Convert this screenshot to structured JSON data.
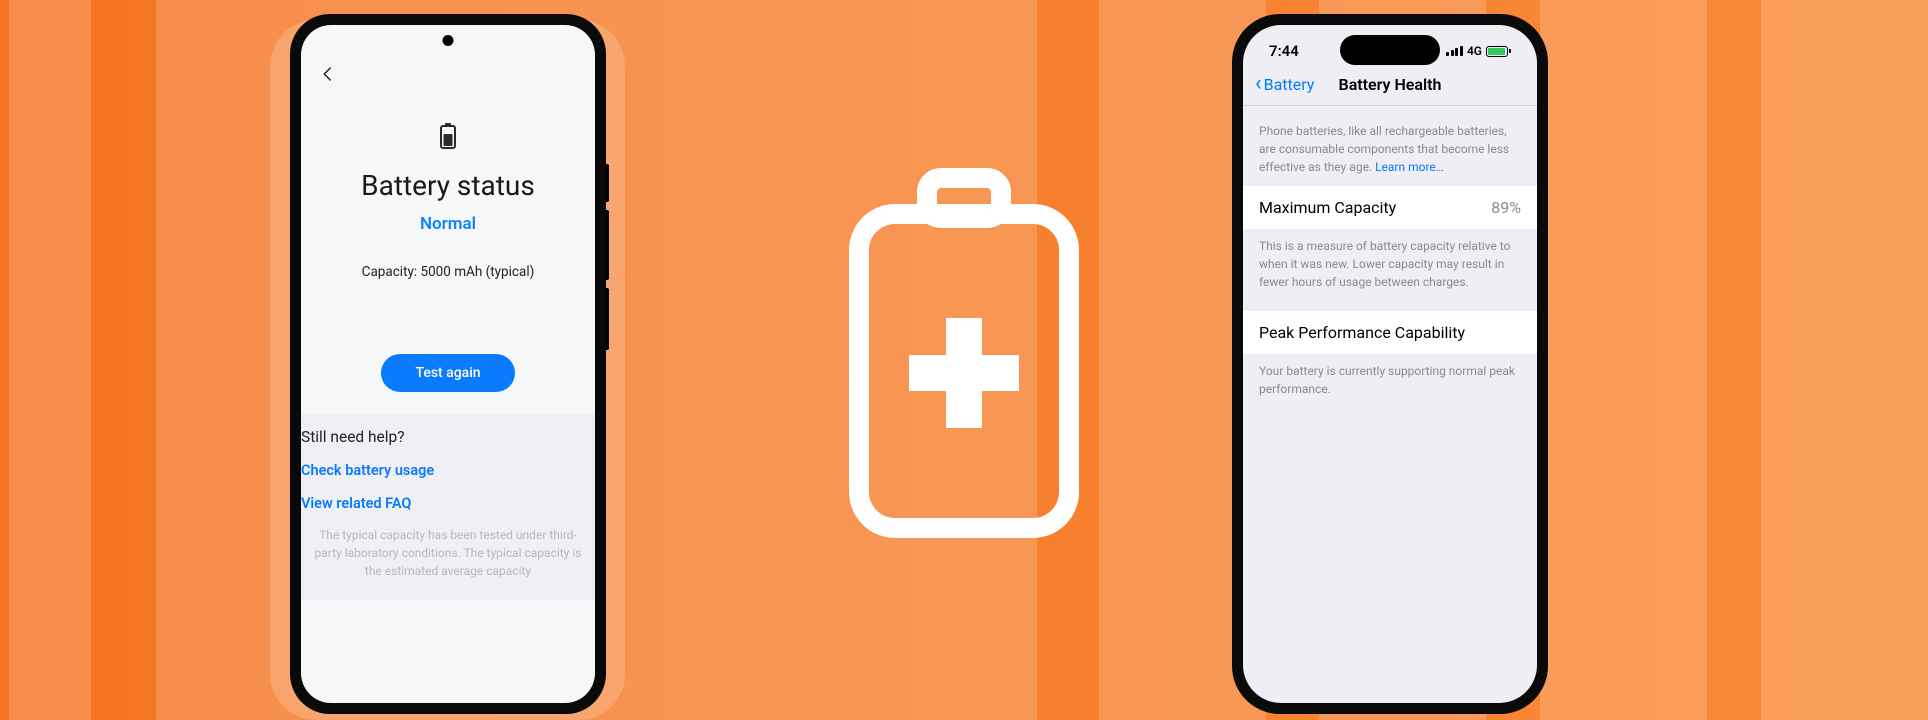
{
  "android": {
    "title": "Battery status",
    "status_label": "Normal",
    "capacity_line": "Capacity: 5000 mAh (typical)",
    "test_button": "Test again",
    "help": {
      "heading": "Still need help?",
      "link_usage": "Check battery usage",
      "link_faq": "View related FAQ"
    },
    "footnote": "The typical capacity has been tested under third-party laboratory conditions. The typical capacity is the estimated average capacity"
  },
  "iphone": {
    "status": {
      "time": "7:44",
      "network": "4G"
    },
    "nav": {
      "back_label": "Battery",
      "title": "Battery Health"
    },
    "intro_text": "Phone batteries, like all rechargeable batteries, are consumable components that become less effective as they age. ",
    "intro_link": "Learn more…",
    "max_capacity": {
      "label": "Maximum Capacity",
      "value": "89%",
      "sub": "This is a measure of battery capacity relative to when it was new. Lower capacity may result in fewer hours of usage between charges."
    },
    "peak": {
      "label": "Peak Performance Capability",
      "sub": "Your battery is currently supporting normal peak performance."
    }
  }
}
